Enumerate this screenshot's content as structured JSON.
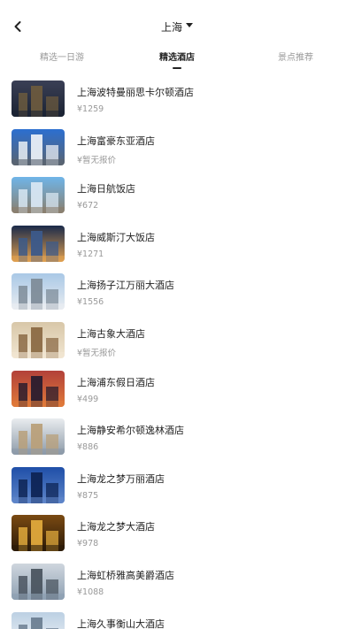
{
  "header": {
    "back_icon": "chevron-left-icon",
    "city": "上海",
    "city_dropdown_icon": "caret-down-icon"
  },
  "tabs": [
    {
      "label": "精选一日游",
      "active": false
    },
    {
      "label": "精选酒店",
      "active": true
    },
    {
      "label": "景点推荐",
      "active": false
    }
  ],
  "hotels": [
    {
      "name": "上海波特曼丽思卡尔顿酒店",
      "price": "¥1259",
      "palette": [
        "#3a3f55",
        "#6b5a3e",
        "#1b2333"
      ]
    },
    {
      "name": "上海富豪东亚酒店",
      "price": "¥暂无报价",
      "palette": [
        "#2c6fd0",
        "#e8eef5",
        "#5a6470"
      ]
    },
    {
      "name": "上海日航饭店",
      "price": "¥672",
      "palette": [
        "#6fb5e8",
        "#d7e6f2",
        "#8a7f6e"
      ]
    },
    {
      "name": "上海威斯汀大饭店",
      "price": "¥1271",
      "palette": [
        "#1a2a4a",
        "#3c5a8a",
        "#e0a050"
      ]
    },
    {
      "name": "上海扬子江万丽大酒店",
      "price": "¥1556",
      "palette": [
        "#a9c8e6",
        "#7e8c99",
        "#e9edf1"
      ]
    },
    {
      "name": "上海古象大酒店",
      "price": "¥暂无报价",
      "palette": [
        "#d8c7a8",
        "#8b6a45",
        "#f1e6d2"
      ]
    },
    {
      "name": "上海浦东假日酒店",
      "price": "¥499",
      "palette": [
        "#b2413a",
        "#2a1c2e",
        "#e07a3a"
      ]
    },
    {
      "name": "上海静安希尔顿逸林酒店",
      "price": "¥886",
      "palette": [
        "#e9ecef",
        "#b9a07a",
        "#8c9aa8"
      ]
    },
    {
      "name": "上海龙之梦万丽酒店",
      "price": "¥875",
      "palette": [
        "#1f4fa8",
        "#0e2455",
        "#5f86c9"
      ]
    },
    {
      "name": "上海龙之梦大酒店",
      "price": "¥978",
      "palette": [
        "#7a4a12",
        "#e0a93c",
        "#2b1a08"
      ]
    },
    {
      "name": "上海虹桥雅高美爵酒店",
      "price": "¥1088",
      "palette": [
        "#cfd6de",
        "#4b5560",
        "#8ea0b2"
      ]
    },
    {
      "name": "上海久事衡山大酒店",
      "price": "",
      "palette": [
        "#bcd0e3",
        "#6d7f92",
        "#f0f3f6"
      ]
    }
  ]
}
